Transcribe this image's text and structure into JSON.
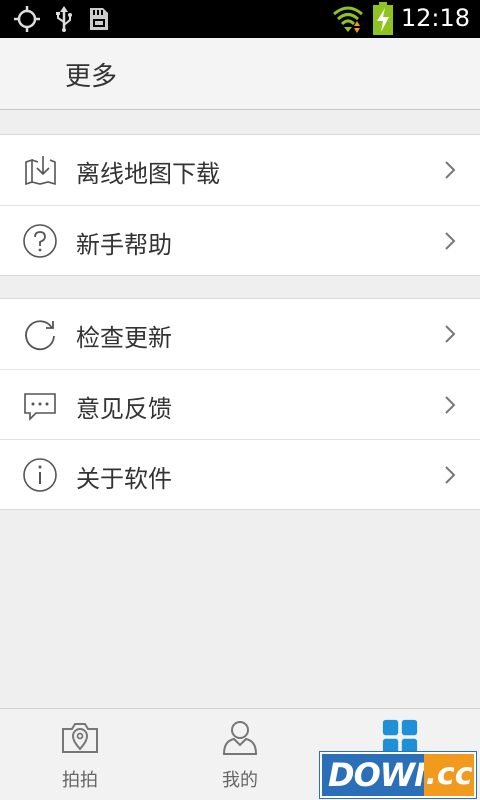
{
  "status_bar": {
    "time": "12:18",
    "icons": [
      "gps-icon",
      "usb-icon",
      "sd-card-icon",
      "wifi-icon",
      "battery-charging-icon"
    ]
  },
  "header": {
    "title": "更多"
  },
  "menu_groups": [
    {
      "items": [
        {
          "label": "离线地图下载",
          "icon": "offline-map-download-icon"
        },
        {
          "label": "新手帮助",
          "icon": "help-icon"
        }
      ]
    },
    {
      "items": [
        {
          "label": "检查更新",
          "icon": "refresh-icon"
        },
        {
          "label": "意见反馈",
          "icon": "feedback-icon"
        },
        {
          "label": "关于软件",
          "icon": "info-icon"
        }
      ]
    }
  ],
  "tab_bar": {
    "tabs": [
      {
        "label": "拍拍",
        "icon": "camera-location-icon",
        "active": false
      },
      {
        "label": "我的",
        "icon": "user-icon",
        "active": false
      },
      {
        "label": "",
        "icon": "grid-icon",
        "active": true
      }
    ],
    "active_color": "#1f8fd6",
    "inactive_color": "#777777"
  },
  "watermark": {
    "text": "DOWN",
    "suffix": ".cc"
  }
}
